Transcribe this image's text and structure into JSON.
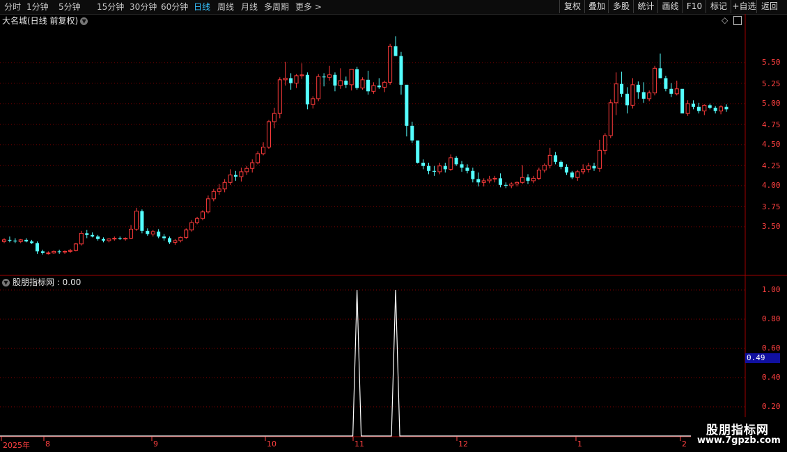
{
  "toolbar": {
    "periods": [
      {
        "label": "分时",
        "active": false
      },
      {
        "label": "1分钟",
        "active": false
      },
      {
        "label": "5分钟",
        "active": false
      },
      {
        "label": "15分钟",
        "active": false
      },
      {
        "label": "30分钟",
        "active": false
      },
      {
        "label": "60分钟",
        "active": false
      },
      {
        "label": "日线",
        "active": true
      },
      {
        "label": "周线",
        "active": false
      },
      {
        "label": "月线",
        "active": false
      },
      {
        "label": "多周期",
        "active": false
      },
      {
        "label": "更多 >",
        "active": false
      }
    ],
    "actions": [
      "复权",
      "叠加",
      "多股",
      "统计",
      "画线",
      "F10",
      "标记",
      "+自选",
      "返回"
    ]
  },
  "main_panel": {
    "title": "大名城(日线 前复权)",
    "y_ticks": [
      "5.50",
      "5.25",
      "5.00",
      "4.75",
      "4.50",
      "4.25",
      "4.00",
      "3.75",
      "3.50"
    ]
  },
  "indicator_panel": {
    "title": "股朋指标网 : 0.00",
    "y_ticks": [
      "1.00",
      "0.80",
      "0.60",
      "0.40",
      "0.20"
    ],
    "current_value": "0.49"
  },
  "x_axis": {
    "labels": [
      "2025年",
      "8",
      "9",
      "10",
      "11",
      "12",
      "1",
      "2"
    ]
  },
  "watermark": {
    "name": "股朋指标网",
    "url": "www.7gpzb.com"
  },
  "colors": {
    "up": "#ff3b3b",
    "down": "#54ffff",
    "grid": "#8b0000",
    "axis_text": "#ff4040",
    "active_tab": "#36c3ff"
  },
  "chart_data": {
    "type": "candlestick",
    "ylim": [
      3.1,
      5.85
    ],
    "candles": [
      [
        3.32,
        3.36,
        3.3,
        3.34
      ],
      [
        3.34,
        3.38,
        3.31,
        3.33
      ],
      [
        3.33,
        3.36,
        3.3,
        3.32
      ],
      [
        3.32,
        3.35,
        3.3,
        3.34
      ],
      [
        3.34,
        3.36,
        3.31,
        3.32
      ],
      [
        3.32,
        3.34,
        3.29,
        3.3
      ],
      [
        3.3,
        3.32,
        3.17,
        3.2
      ],
      [
        3.2,
        3.22,
        3.16,
        3.18
      ],
      [
        3.18,
        3.2,
        3.16,
        3.18
      ],
      [
        3.18,
        3.21,
        3.17,
        3.2
      ],
      [
        3.2,
        3.22,
        3.17,
        3.19
      ],
      [
        3.19,
        3.21,
        3.17,
        3.2
      ],
      [
        3.2,
        3.23,
        3.18,
        3.21
      ],
      [
        3.21,
        3.3,
        3.2,
        3.29
      ],
      [
        3.29,
        3.45,
        3.27,
        3.42
      ],
      [
        3.42,
        3.46,
        3.36,
        3.4
      ],
      [
        3.4,
        3.43,
        3.37,
        3.38
      ],
      [
        3.38,
        3.4,
        3.33,
        3.35
      ],
      [
        3.35,
        3.37,
        3.31,
        3.33
      ],
      [
        3.33,
        3.36,
        3.31,
        3.35
      ],
      [
        3.35,
        3.38,
        3.33,
        3.36
      ],
      [
        3.36,
        3.38,
        3.34,
        3.35
      ],
      [
        3.35,
        3.37,
        3.33,
        3.36
      ],
      [
        3.36,
        3.52,
        3.35,
        3.47
      ],
      [
        3.47,
        3.73,
        3.45,
        3.69
      ],
      [
        3.69,
        3.71,
        3.42,
        3.45
      ],
      [
        3.45,
        3.48,
        3.39,
        3.41
      ],
      [
        3.41,
        3.46,
        3.38,
        3.44
      ],
      [
        3.44,
        3.47,
        3.36,
        3.38
      ],
      [
        3.38,
        3.41,
        3.33,
        3.36
      ],
      [
        3.36,
        3.38,
        3.29,
        3.31
      ],
      [
        3.31,
        3.35,
        3.28,
        3.33
      ],
      [
        3.33,
        3.38,
        3.31,
        3.37
      ],
      [
        3.37,
        3.48,
        3.35,
        3.46
      ],
      [
        3.46,
        3.58,
        3.44,
        3.55
      ],
      [
        3.55,
        3.62,
        3.53,
        3.6
      ],
      [
        3.6,
        3.7,
        3.58,
        3.68
      ],
      [
        3.68,
        3.88,
        3.66,
        3.84
      ],
      [
        3.84,
        3.96,
        3.81,
        3.93
      ],
      [
        3.93,
        4.02,
        3.89,
        3.96
      ],
      [
        3.96,
        4.08,
        3.92,
        4.04
      ],
      [
        4.04,
        4.2,
        4.01,
        4.13
      ],
      [
        4.13,
        4.18,
        4.06,
        4.11
      ],
      [
        4.11,
        4.22,
        4.05,
        4.17
      ],
      [
        4.17,
        4.24,
        4.13,
        4.21
      ],
      [
        4.21,
        4.32,
        4.16,
        4.28
      ],
      [
        4.28,
        4.42,
        4.26,
        4.39
      ],
      [
        4.39,
        4.53,
        4.37,
        4.47
      ],
      [
        4.47,
        4.8,
        4.45,
        4.78
      ],
      [
        4.78,
        4.95,
        4.7,
        4.88
      ],
      [
        4.88,
        5.32,
        4.82,
        5.29
      ],
      [
        5.29,
        5.51,
        5.22,
        5.31
      ],
      [
        5.31,
        5.37,
        5.17,
        5.25
      ],
      [
        5.25,
        5.36,
        5.19,
        5.34
      ],
      [
        5.34,
        5.49,
        5.3,
        5.35
      ],
      [
        5.35,
        5.38,
        4.93,
        4.99
      ],
      [
        4.99,
        5.09,
        4.94,
        5.06
      ],
      [
        5.06,
        5.36,
        5.03,
        5.33
      ],
      [
        5.33,
        5.37,
        5.21,
        5.32
      ],
      [
        5.32,
        5.46,
        5.28,
        5.35
      ],
      [
        5.35,
        5.38,
        5.15,
        5.22
      ],
      [
        5.22,
        5.43,
        5.18,
        5.28
      ],
      [
        5.28,
        5.33,
        5.19,
        5.23
      ],
      [
        5.23,
        5.37,
        5.16,
        5.42
      ],
      [
        5.42,
        5.45,
        5.17,
        5.19
      ],
      [
        5.19,
        5.32,
        5.17,
        5.29
      ],
      [
        5.29,
        5.4,
        5.11,
        5.15
      ],
      [
        5.15,
        5.26,
        5.12,
        5.22
      ],
      [
        5.22,
        5.31,
        5.18,
        5.2
      ],
      [
        5.2,
        5.28,
        5.14,
        5.26
      ],
      [
        5.26,
        5.73,
        5.23,
        5.7
      ],
      [
        5.7,
        5.82,
        5.58,
        5.58
      ],
      [
        5.58,
        5.63,
        5.11,
        5.23
      ],
      [
        5.23,
        5.07,
        4.6,
        4.73
      ],
      [
        4.73,
        4.78,
        4.52,
        4.55
      ],
      [
        4.55,
        4.53,
        4.27,
        4.28
      ],
      [
        4.28,
        4.32,
        4.2,
        4.24
      ],
      [
        4.24,
        4.28,
        4.14,
        4.18
      ],
      [
        4.18,
        4.24,
        4.12,
        4.17
      ],
      [
        4.17,
        4.28,
        4.14,
        4.24
      ],
      [
        4.24,
        4.28,
        4.16,
        4.2
      ],
      [
        4.2,
        4.38,
        4.18,
        4.34
      ],
      [
        4.34,
        4.36,
        4.24,
        4.26
      ],
      [
        4.26,
        4.3,
        4.17,
        4.22
      ],
      [
        4.22,
        4.26,
        4.15,
        4.18
      ],
      [
        4.18,
        4.22,
        4.04,
        4.08
      ],
      [
        4.08,
        4.16,
        3.99,
        4.04
      ],
      [
        4.04,
        4.09,
        3.99,
        4.06
      ],
      [
        4.06,
        4.12,
        4.03,
        4.08
      ],
      [
        4.08,
        4.12,
        4.04,
        4.09
      ],
      [
        4.09,
        4.15,
        3.98,
        4.01
      ],
      [
        4.01,
        4.04,
        3.97,
        4.0
      ],
      [
        4.0,
        4.04,
        3.97,
        4.02
      ],
      [
        4.02,
        4.05,
        3.99,
        4.04
      ],
      [
        4.04,
        4.25,
        4.02,
        4.1
      ],
      [
        4.1,
        4.14,
        4.02,
        4.06
      ],
      [
        4.06,
        4.12,
        4.03,
        4.09
      ],
      [
        4.09,
        4.22,
        4.07,
        4.19
      ],
      [
        4.19,
        4.27,
        4.16,
        4.25
      ],
      [
        4.25,
        4.46,
        4.21,
        4.37
      ],
      [
        4.37,
        4.41,
        4.26,
        4.29
      ],
      [
        4.29,
        4.31,
        4.2,
        4.23
      ],
      [
        4.23,
        4.26,
        4.13,
        4.16
      ],
      [
        4.16,
        4.18,
        4.08,
        4.1
      ],
      [
        4.1,
        4.19,
        4.06,
        4.17
      ],
      [
        4.17,
        4.26,
        4.14,
        4.2
      ],
      [
        4.2,
        4.28,
        4.16,
        4.24
      ],
      [
        4.24,
        4.28,
        4.18,
        4.21
      ],
      [
        4.21,
        4.56,
        4.17,
        4.43
      ],
      [
        4.43,
        4.64,
        4.38,
        4.61
      ],
      [
        4.61,
        5.05,
        4.58,
        5.01
      ],
      [
        5.01,
        5.38,
        4.86,
        5.24
      ],
      [
        5.24,
        5.39,
        5.08,
        5.12
      ],
      [
        5.12,
        5.2,
        4.88,
        4.98
      ],
      [
        4.98,
        5.31,
        4.94,
        5.23
      ],
      [
        5.23,
        5.27,
        5.06,
        5.14
      ],
      [
        5.14,
        5.26,
        5.01,
        5.06
      ],
      [
        5.06,
        5.16,
        5.03,
        5.13
      ],
      [
        5.13,
        5.46,
        5.1,
        5.43
      ],
      [
        5.43,
        5.61,
        5.31,
        5.31
      ],
      [
        5.31,
        5.34,
        5.15,
        5.18
      ],
      [
        5.18,
        5.25,
        5.08,
        5.12
      ],
      [
        5.12,
        5.28,
        5.1,
        5.18
      ],
      [
        5.18,
        5.05,
        4.9,
        4.88
      ],
      [
        4.88,
        5.04,
        4.85,
        5.0
      ],
      [
        5.0,
        5.04,
        4.93,
        4.96
      ],
      [
        4.96,
        5.01,
        4.88,
        4.91
      ],
      [
        4.91,
        4.99,
        4.86,
        4.98
      ],
      [
        4.98,
        5.0,
        4.93,
        4.95
      ],
      [
        4.95,
        4.97,
        4.88,
        4.91
      ],
      [
        4.91,
        4.98,
        4.87,
        4.96
      ],
      [
        4.96,
        4.99,
        4.9,
        4.93
      ]
    ],
    "indicator_series": {
      "name": "股朋指标网",
      "spikes_at_candle_index": [
        64,
        71
      ],
      "values_are": "0 except 1.00 at spikes"
    }
  }
}
